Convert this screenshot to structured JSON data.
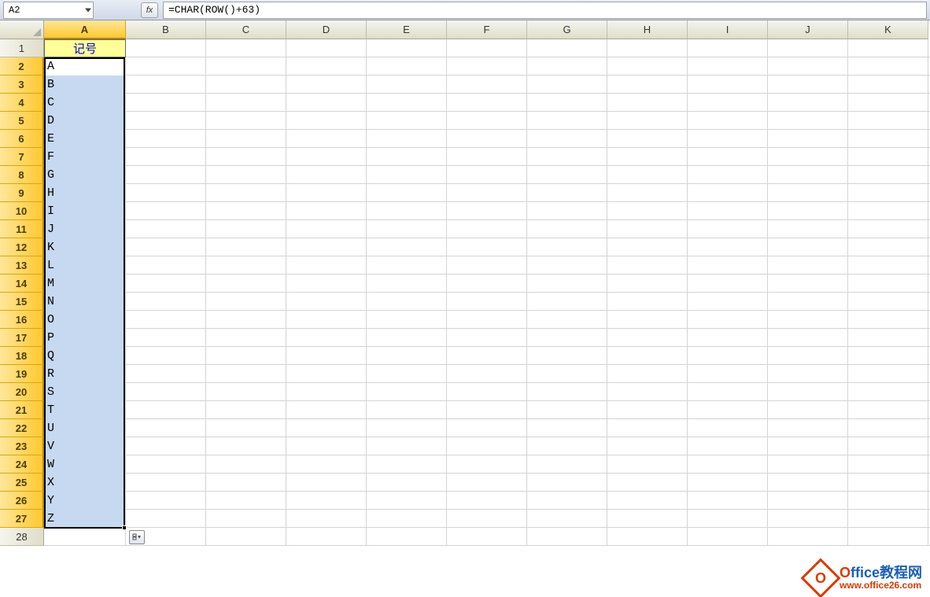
{
  "name_box": "A2",
  "fx_label": "fx",
  "formula": "=CHAR(ROW()+63)",
  "columns": [
    "A",
    "B",
    "C",
    "D",
    "E",
    "F",
    "G",
    "H",
    "I",
    "J",
    "K"
  ],
  "active_column": "A",
  "rows": [
    1,
    2,
    3,
    4,
    5,
    6,
    7,
    8,
    9,
    10,
    11,
    12,
    13,
    14,
    15,
    16,
    17,
    18,
    19,
    20,
    21,
    22,
    23,
    24,
    25,
    26,
    27,
    28
  ],
  "active_rows_start": 2,
  "active_rows_end": 27,
  "header_cell": "记号",
  "data": [
    "A",
    "B",
    "C",
    "D",
    "E",
    "F",
    "G",
    "H",
    "I",
    "J",
    "K",
    "L",
    "M",
    "N",
    "O",
    "P",
    "Q",
    "R",
    "S",
    "T",
    "U",
    "V",
    "W",
    "X",
    "Y",
    "Z"
  ],
  "watermark": {
    "icon_letter": "O",
    "title_prefix": "O",
    "title_rest": "ffice教程网",
    "url": "www.office26.com"
  }
}
